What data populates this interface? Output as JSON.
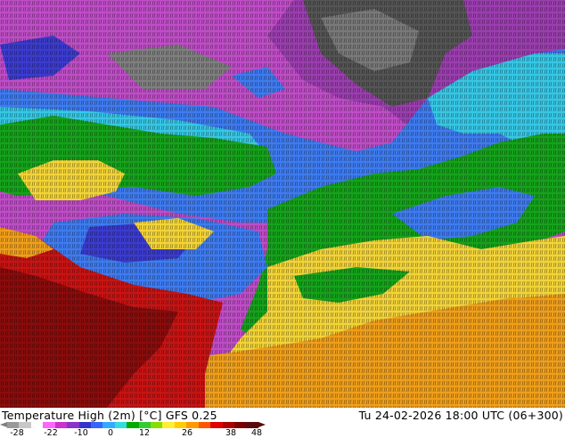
{
  "footer": {
    "title": "Temperature High (2m) [°C] GFS 0.25",
    "timestamp": "Tu 24-02-2026 18:00 UTC (06+300)"
  },
  "legend": {
    "ticks": [
      "-28",
      "-22",
      "-10",
      "0",
      "12",
      "26",
      "38",
      "48"
    ],
    "colors": [
      "#9a9a9a",
      "#c8c8c8",
      "#ffffff",
      "#ff66ff",
      "#cc33cc",
      "#8833cc",
      "#3333cc",
      "#3366ff",
      "#33aaff",
      "#33dddd",
      "#00aa00",
      "#33cc33",
      "#88dd00",
      "#ffee33",
      "#ffcc00",
      "#ff9900",
      "#ff5500",
      "#dd0000",
      "#aa0000",
      "#7a0000",
      "#5a0a0a"
    ]
  },
  "map": {
    "palette": {
      "magenta": "#c04ec8",
      "purple": "#9c3fb0",
      "gray_dark": "#555555",
      "gray_light": "#9a9a9a",
      "blue_deep": "#3c3ccf",
      "blue": "#3f7cf0",
      "cyan": "#38c8e6",
      "green": "#16a31c",
      "green_dark": "#0f8a12",
      "yellow": "#f4d53a",
      "orange": "#f0a01c",
      "red": "#c81414",
      "darkred": "#7f0a0a"
    }
  }
}
